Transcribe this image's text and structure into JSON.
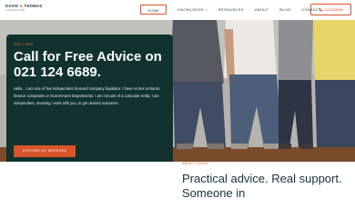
{
  "header": {
    "logo_name": "DAVID & THOMAS",
    "logo_name_part1": "DAVID",
    "logo_amp": "&",
    "logo_name_part2": "THOMAS",
    "logo_sub": "LIQUIDATOR",
    "nav": [
      {
        "label": "HOME",
        "active": true
      },
      {
        "label": "KNOWLEDGE",
        "has_dropdown": true
      },
      {
        "label": "RESOURCES"
      },
      {
        "label": "ABOUT"
      },
      {
        "label": "BLOG"
      },
      {
        "label": "CONTACT"
      }
    ],
    "phone_label": "0211246689",
    "phone_icon": "phone-icon"
  },
  "hero": {
    "eyebrow": "WELCOME",
    "headline": "Call for Free Advice on 021 124 6689.",
    "paragraph": "Hello... I am one of few independent licensed company liquidator. I have no ties to Banks finance companies or Government Departments. I am not part of a corporate entity. I am independent, meaning I work with you, to get desired outcomes.",
    "cta_label": "EXPLORE MY SERVICES"
  },
  "about": {
    "eyebrow": "ABOUT DAVID",
    "title": "Practical advice. Real support. Someone in"
  },
  "colors": {
    "accent": "#d9542b",
    "card_bg": "#12322f",
    "text_dark": "#17333a"
  }
}
